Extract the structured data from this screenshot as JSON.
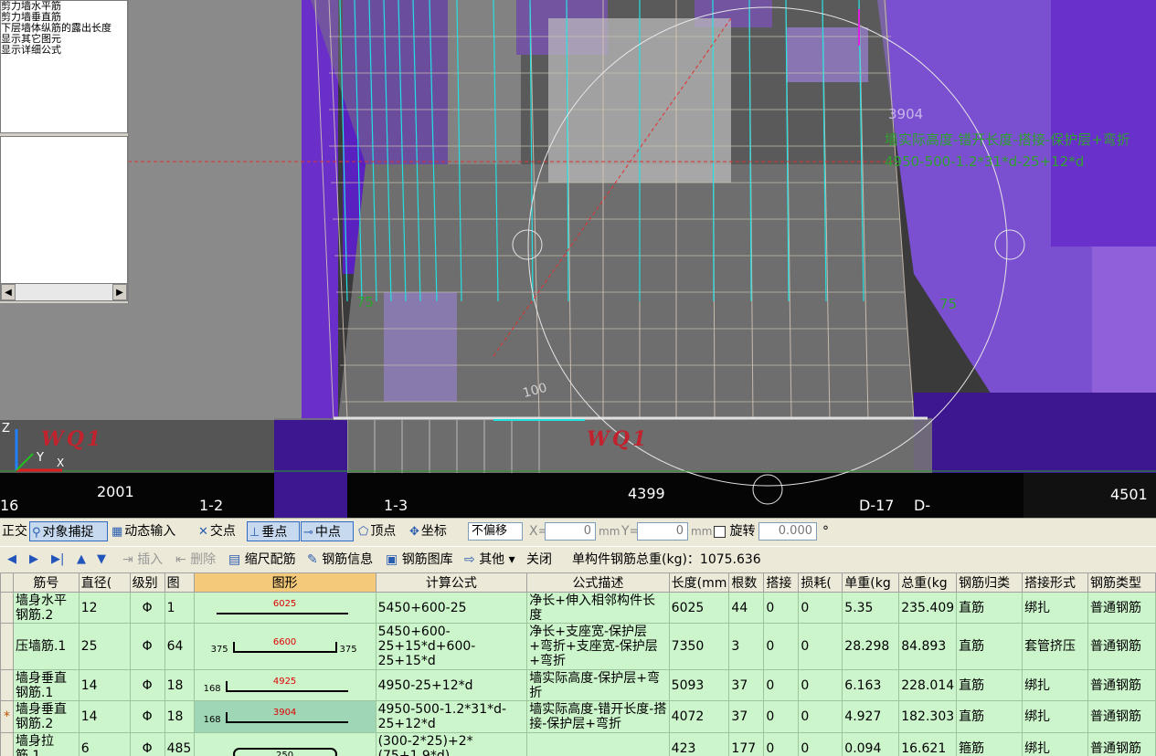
{
  "layer_list": [
    "剪力墙水平筋",
    "剪力墙垂直筋",
    "下层墙体纵筋的露出长度",
    "显示其它图元",
    "显示详细公式"
  ],
  "viewport": {
    "dim_top": "3904",
    "formula_label": "墙实际高度-错开长度-搭接-保护层+弯折",
    "formula_value": "4950-500-1.2*31*d-25+12*d",
    "label_75_left": "75",
    "label_75_right": "75",
    "label_100": "100",
    "wall_name_left": "WQ1",
    "wall_name_center": "WQ1",
    "axis_x": "X",
    "axis_y": "Y",
    "axis_z": "Z",
    "bottom_labels": [
      "16",
      "2001",
      "1-2",
      "1-3",
      "4399",
      "D-17",
      "D-",
      "4501"
    ]
  },
  "snapbar": {
    "ortho": "正交",
    "object_snap": "对象捕捉",
    "dynamic_input": "动态输入",
    "intersection": "交点",
    "perpendicular": "垂点",
    "midpoint": "中点",
    "vertex": "顶点",
    "coordinate": "坐标",
    "offset_select": "不偏移",
    "x_label": "X=",
    "x_value": "0",
    "y_label": "Y=",
    "y_value": "0",
    "unit_mm": "mm",
    "rotate_label": "旋转",
    "rotate_value": "0.000",
    "degree": "°"
  },
  "rebarbar": {
    "insert": "插入",
    "delete": "删除",
    "scale_rebar": "缩尺配筋",
    "rebar_info": "钢筋信息",
    "rebar_library": "钢筋图库",
    "other": "其他",
    "close": "关闭",
    "total_weight": "单构件钢筋总重(kg)：1075.636"
  },
  "table": {
    "columns": [
      "筋号",
      "直径(",
      "级别",
      "图",
      "图形",
      "计算公式",
      "公式描述",
      "长度(mm",
      "根数",
      "搭接",
      "损耗(",
      "单重(kg",
      "总重(kg",
      "钢筋归类",
      "搭接形式",
      "钢筋类型"
    ],
    "rows": [
      {
        "marker": "",
        "name": "墙身水平钢筋.2",
        "dia": "12",
        "grade": "Φ",
        "fig": "1",
        "shape_num": "6025",
        "left_num": "",
        "right_num": "",
        "formula": "5450+600-25",
        "desc": "净长+伸入相邻构件长度",
        "len": "6025",
        "count": "44",
        "lap": "0",
        "loss": "0",
        "unit_w": "5.35",
        "total_w": "235.409",
        "cat": "直筋",
        "lap_type": "绑扎",
        "type": "普通钢筋"
      },
      {
        "marker": "",
        "name": "压墙筋.1",
        "dia": "25",
        "grade": "Φ",
        "fig": "64",
        "shape_num": "6600",
        "left_num": "375",
        "right_num": "375",
        "formula": "5450+600-25+15*d+600-25+15*d",
        "desc": "净长+支座宽-保护层+弯折+支座宽-保护层+弯折",
        "len": "7350",
        "count": "3",
        "lap": "0",
        "loss": "0",
        "unit_w": "28.298",
        "total_w": "84.893",
        "cat": "直筋",
        "lap_type": "套管挤压",
        "type": "普通钢筋"
      },
      {
        "marker": "",
        "name": "墙身垂直钢筋.1",
        "dia": "14",
        "grade": "Φ",
        "fig": "18",
        "shape_num": "4925",
        "left_num": "168",
        "right_num": "",
        "formula": "4950-25+12*d",
        "desc": "墙实际高度-保护层+弯折",
        "len": "5093",
        "count": "37",
        "lap": "0",
        "loss": "0",
        "unit_w": "6.163",
        "total_w": "228.014",
        "cat": "直筋",
        "lap_type": "绑扎",
        "type": "普通钢筋"
      },
      {
        "marker": "*",
        "name": "墙身垂直钢筋.2",
        "dia": "14",
        "grade": "Φ",
        "fig": "18",
        "shape_num": "3904",
        "left_num": "168",
        "right_num": "",
        "formula": "4950-500-1.2*31*d-25+12*d",
        "desc": "墙实际高度-错开长度-搭接-保护层+弯折",
        "len": "4072",
        "count": "37",
        "lap": "0",
        "loss": "0",
        "unit_w": "4.927",
        "total_w": "182.303",
        "cat": "直筋",
        "lap_type": "绑扎",
        "type": "普通钢筋"
      },
      {
        "marker": "",
        "name": "墙身拉筋.1",
        "dia": "6",
        "grade": "Φ",
        "fig": "485",
        "shape_num": "250",
        "left_num": "",
        "right_num": "",
        "formula": "(300-2*25)+2*(75+1.9*d)",
        "desc": "",
        "len": "423",
        "count": "177",
        "lap": "0",
        "loss": "0",
        "unit_w": "0.094",
        "total_w": "16.621",
        "cat": "箍筋",
        "lap_type": "绑扎",
        "type": "普通钢筋"
      }
    ]
  }
}
